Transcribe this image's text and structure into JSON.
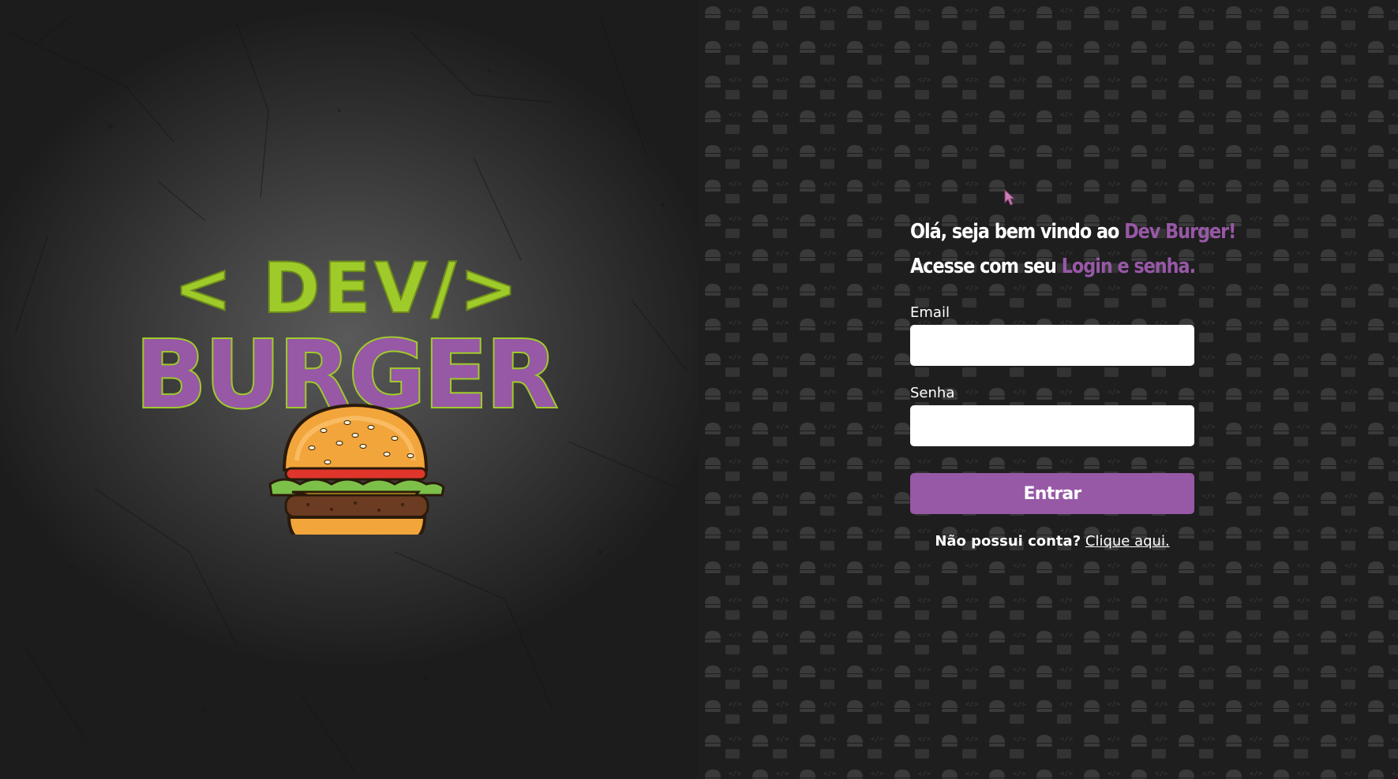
{
  "brand": {
    "logo_top": "< DEV/>",
    "logo_bottom": "BURGER",
    "colors": {
      "lime": "#9fcb2a",
      "purple": "#9758a6",
      "dark_outline": "#6d8a1c"
    }
  },
  "welcome": {
    "line1_prefix": "Olá, seja bem vindo ao ",
    "line1_accent": "Dev Burger!",
    "line2_prefix": "Acesse com seu ",
    "line2_accent": "Login e senha."
  },
  "form": {
    "email_label": "Email",
    "email_value": "",
    "password_label": "Senha",
    "password_value": "",
    "submit_label": "Entrar"
  },
  "signup": {
    "question": "Não possui conta?",
    "link_text": "Clique aqui."
  },
  "icons": {
    "cursor": "mouse-pointer-icon",
    "burger": "burger-illustration-icon"
  },
  "colors": {
    "accent": "#9758a6",
    "panel_dark": "#1e1e1e",
    "text": "#ffffff"
  }
}
